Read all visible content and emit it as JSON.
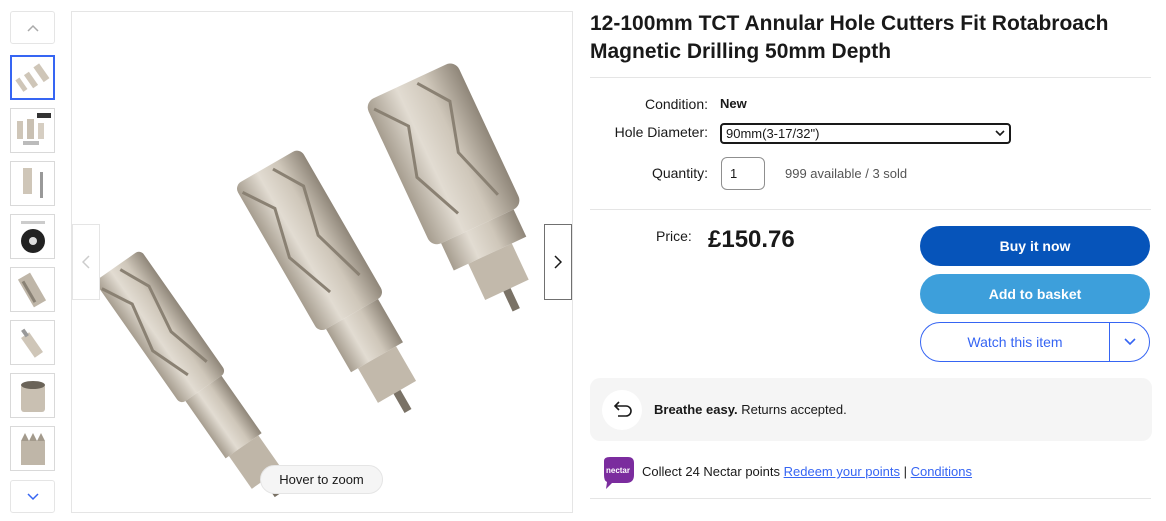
{
  "gallery": {
    "thumbnails": [
      {
        "name": "three-cutters"
      },
      {
        "name": "cutters-with-brand-box"
      },
      {
        "name": "single-cutter-with-pin"
      },
      {
        "name": "cutter-end-view"
      },
      {
        "name": "cutter-closeup"
      },
      {
        "name": "cutter-shank"
      },
      {
        "name": "cutter-teeth-top"
      },
      {
        "name": "cutter-teeth-side"
      }
    ],
    "zoom_label": "Hover to zoom"
  },
  "product": {
    "title": "12-100mm TCT Annular Hole Cutters Fit Rotabroach Magnetic Drilling 50mm Depth",
    "condition_label": "Condition:",
    "condition_value": "New",
    "hole_label": "Hole Diameter:",
    "hole_selected": "90mm(3-17/32\")",
    "quantity_label": "Quantity:",
    "quantity_value": "1",
    "availability": "999 available / 3 sold"
  },
  "pricing": {
    "price_label": "Price:",
    "price": "£150.76"
  },
  "actions": {
    "buy_now": "Buy it now",
    "add_to_basket": "Add to basket",
    "watch": "Watch this item"
  },
  "returns": {
    "bold": "Breathe easy.",
    "text": " Returns accepted."
  },
  "nectar": {
    "logo_text": "nectar",
    "collect": "Collect 24 Nectar points ",
    "redeem_link": "Redeem your points",
    "separator": " | ",
    "conditions_link": "Conditions"
  },
  "colors": {
    "buy_now": "#0654ba",
    "add_to_basket": "#3d9fdb",
    "link": "#3665f3",
    "nectar": "#6a1b9a"
  }
}
